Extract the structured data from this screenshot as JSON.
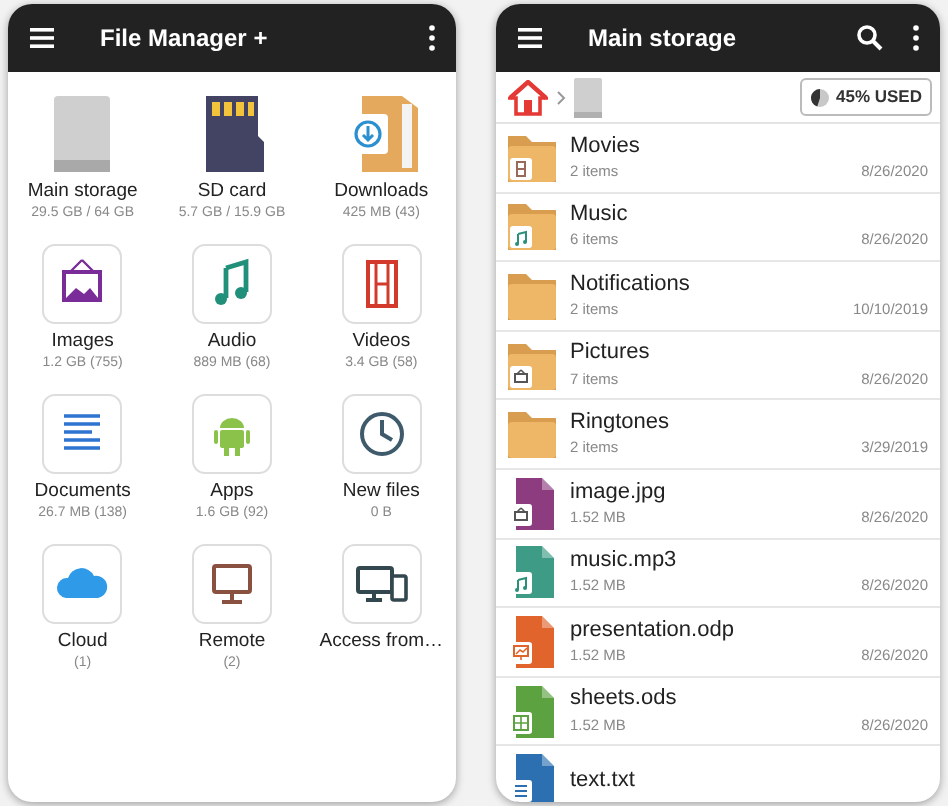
{
  "left": {
    "title": "File Manager +",
    "tiles": [
      {
        "kind": "drive",
        "label": "Main storage",
        "detail": "29.5 GB / 64 GB"
      },
      {
        "kind": "sdcard",
        "label": "SD card",
        "detail": "5.7 GB / 15.9 GB"
      },
      {
        "kind": "downloads",
        "label": "Downloads",
        "detail": "425 MB (43)"
      },
      {
        "kind": "images",
        "label": "Images",
        "detail": "1.2 GB (755)"
      },
      {
        "kind": "audio",
        "label": "Audio",
        "detail": "889 MB (68)"
      },
      {
        "kind": "videos",
        "label": "Videos",
        "detail": "3.4 GB (58)"
      },
      {
        "kind": "documents",
        "label": "Documents",
        "detail": "26.7 MB (138)"
      },
      {
        "kind": "apps",
        "label": "Apps",
        "detail": "1.6 GB (92)"
      },
      {
        "kind": "recent",
        "label": "New files",
        "detail": "0 B"
      },
      {
        "kind": "cloud",
        "label": "Cloud",
        "detail": "(1)"
      },
      {
        "kind": "remote",
        "label": "Remote",
        "detail": "(2)"
      },
      {
        "kind": "access",
        "label": "Access from…"
      }
    ]
  },
  "right": {
    "title": "Main storage",
    "usage": {
      "level": 0.45,
      "label": "45% USED"
    },
    "items": [
      {
        "kind": "movies",
        "name": "Movies",
        "details": "2 items",
        "date": "8/26/2020"
      },
      {
        "kind": "music",
        "name": "Music",
        "details": "6 items",
        "date": "8/26/2020"
      },
      {
        "kind": "folder",
        "name": "Notifications",
        "details": "2 items",
        "date": "10/10/2019"
      },
      {
        "kind": "pictures",
        "name": "Pictures",
        "details": "7 items",
        "date": "8/26/2020"
      },
      {
        "kind": "folder",
        "name": "Ringtones",
        "details": "2 items",
        "date": "3/29/2019"
      },
      {
        "kind": "image",
        "color": "#8e3c80",
        "name": "image.jpg",
        "details": "1.52 MB",
        "date": "8/26/2020"
      },
      {
        "kind": "audio",
        "color": "#3e9c86",
        "name": "music.mp3",
        "details": "1.52 MB",
        "date": "8/26/2020"
      },
      {
        "kind": "slides",
        "color": "#e0642c",
        "name": "presentation.odp",
        "details": "1.52 MB",
        "date": "8/26/2020"
      },
      {
        "kind": "sheet",
        "color": "#5ca240",
        "name": "sheets.ods",
        "details": "1.52 MB",
        "date": "8/26/2020"
      },
      {
        "kind": "text",
        "color": "#2c70b2",
        "name": "text.txt"
      }
    ]
  }
}
